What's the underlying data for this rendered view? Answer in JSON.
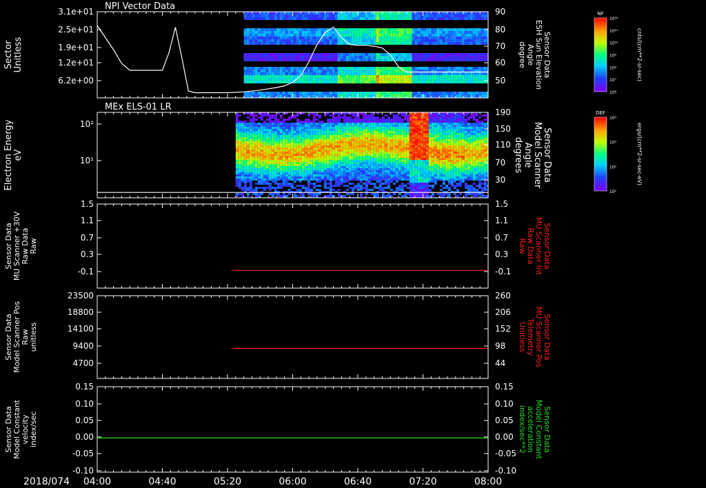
{
  "date_label": "2018/074",
  "x_ticks": [
    "04:00",
    "04:40",
    "05:20",
    "06:00",
    "06:40",
    "07:20",
    "08:00"
  ],
  "colors": {
    "background": "#000000",
    "axes": "#ffffff",
    "red_trace": "#ff2020",
    "green_trace": "#20e020"
  },
  "colorbars": [
    {
      "tag": "NF",
      "unit_label": "cnts/(cm**2-sr-sec)",
      "ticks": [
        "10¹²",
        "10¹¹",
        "10¹⁰",
        "10⁹",
        "10⁸",
        "10⁷",
        "10⁶"
      ]
    },
    {
      "tag": "DEF",
      "unit_label": "ergs/(cm**2-sr-sec-eV)",
      "ticks": [
        "10⁴",
        "10³",
        "10²",
        "10¹"
      ]
    }
  ],
  "chart_data": [
    {
      "type": "heatmap",
      "title": "NPI Vector Data",
      "left_label": [
        "Sector",
        "Unitless"
      ],
      "right_label": [
        "Sensor Data",
        "ESH Sun Elevation",
        "Angle",
        "degree"
      ],
      "left_ticks": [
        "3.1e+01",
        "2.5e+01",
        "1.9e+01",
        "1.2e+01",
        "6.2e+00"
      ],
      "right_ticks": [
        "90",
        "80",
        "70",
        "60",
        "50"
      ],
      "ylim_right": [
        40,
        90
      ],
      "spectrogram_start": "05:30",
      "line_series": {
        "x": [
          "04:00",
          "04:10",
          "04:15",
          "04:20",
          "04:30",
          "04:40",
          "04:44",
          "04:48",
          "04:52",
          "04:56",
          "05:00",
          "05:10",
          "05:20",
          "05:30",
          "05:40",
          "05:50",
          "05:55",
          "06:00",
          "06:05",
          "06:10",
          "06:15",
          "06:20",
          "06:25",
          "06:30",
          "06:35",
          "06:40",
          "06:45",
          "06:50",
          "06:55",
          "07:00",
          "07:05",
          "07:10",
          "07:20",
          "07:30",
          "07:40",
          "07:50",
          "08:00"
        ],
        "y": [
          82,
          68,
          60,
          56,
          56,
          56,
          66,
          81,
          63,
          44,
          43,
          43,
          43,
          43.5,
          44.5,
          46,
          47,
          49,
          53,
          61,
          71,
          78,
          81,
          75,
          71,
          70.5,
          70.5,
          70,
          69,
          65,
          58,
          55,
          55,
          55,
          55,
          55,
          55
        ]
      }
    },
    {
      "type": "heatmap",
      "title": "MEx ELS-01 LR",
      "left_label": [
        "Electron Energy",
        "eV"
      ],
      "right_label": [
        "Sensor Data",
        "Model Scanner",
        "Angle",
        "degrees"
      ],
      "left_ticks": [
        "10²",
        "10¹"
      ],
      "right_ticks": [
        "190",
        "150",
        "110",
        "70",
        "30"
      ],
      "ylim_right": [
        0,
        190
      ],
      "spectrogram_start": "05:25",
      "line_series": {
        "x": [
          "04:00",
          "08:00"
        ],
        "y": [
          12,
          12
        ]
      }
    },
    {
      "type": "line",
      "left_label": [
        "Sensor Data",
        "MU Scanner +30V",
        "Raw Data",
        "Raw"
      ],
      "right_label": [
        "Sensor Data",
        "MU Scanner Int",
        "Raw Data",
        "Raw"
      ],
      "left_ticks": [
        "1.5",
        "1.1",
        "0.7",
        "0.3",
        "-0.1"
      ],
      "right_ticks": [
        "1.5",
        "1.1",
        "0.7",
        "0.3",
        "-0.1"
      ],
      "ylim": [
        -0.4,
        1.5
      ],
      "series": [
        {
          "x": [
            "05:23",
            "08:00"
          ],
          "y": [
            0.0,
            0.0
          ],
          "color": "#ff2020"
        }
      ]
    },
    {
      "type": "line",
      "left_label": [
        "Sensor Data",
        "Model Scanner Pos",
        "Raw",
        "unitless"
      ],
      "right_label": [
        "Sensor Data",
        "MU Scanner Pos",
        "Telemetry",
        "Unitless"
      ],
      "left_ticks": [
        "23500",
        "18800",
        "14100",
        "9400",
        "4700"
      ],
      "right_ticks": [
        "260",
        "206",
        "152",
        "98",
        "44"
      ],
      "ylim_right": [
        -10,
        260
      ],
      "series": [
        {
          "x": [
            "05:23",
            "08:00"
          ],
          "y": [
            88,
            88
          ],
          "color": "#ff2020"
        }
      ]
    },
    {
      "type": "line",
      "left_label": [
        "Sensor Data",
        "Model Constant",
        "velocity",
        "index/sec"
      ],
      "right_label": [
        "Sensor Data",
        "Model Constant",
        "acceleration",
        "index/sec**2"
      ],
      "left_ticks": [
        "0.15",
        "0.10",
        "0.05",
        "0.00",
        "-0.05",
        "-0.10"
      ],
      "right_ticks": [
        "0.15",
        "0.10",
        "0.05",
        "0.00",
        "-0.05",
        "-0.10"
      ],
      "ylim": [
        -0.1,
        0.15
      ],
      "series": [
        {
          "x": [
            "04:00",
            "08:00"
          ],
          "y": [
            0.0,
            0.0
          ],
          "color": "#20e020"
        }
      ]
    }
  ]
}
